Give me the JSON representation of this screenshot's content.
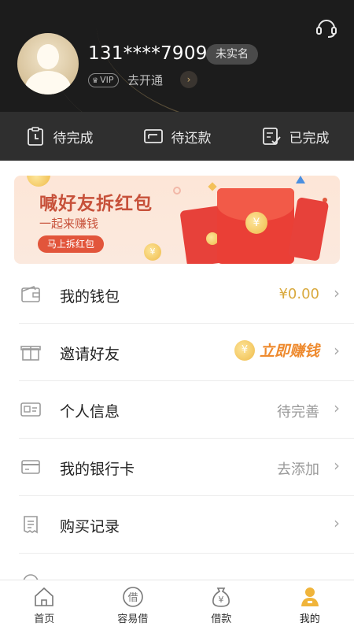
{
  "profile": {
    "phone": "131****7909",
    "real_name_status": "未实名",
    "vip_label": "VIP",
    "vip_action": "去开通"
  },
  "status_tabs": [
    {
      "label": "待完成",
      "icon": "clipboard-clock-icon"
    },
    {
      "label": "待还款",
      "icon": "card-return-icon"
    },
    {
      "label": "已完成",
      "icon": "clipboard-check-icon"
    }
  ],
  "banner": {
    "title": "喊好友拆红包",
    "subtitle": "一起来赚钱",
    "button": "马上拆红包",
    "coin_symbol": "¥"
  },
  "menu": [
    {
      "label": "我的钱包",
      "value": "¥0.00",
      "icon": "wallet-icon"
    },
    {
      "label": "邀请好友",
      "value": "立即赚钱",
      "icon": "gift-icon"
    },
    {
      "label": "个人信息",
      "value": "待完善",
      "icon": "id-card-icon"
    },
    {
      "label": "我的银行卡",
      "value": "去添加",
      "icon": "bank-card-icon"
    },
    {
      "label": "购买记录",
      "value": "",
      "icon": "receipt-icon"
    }
  ],
  "bottom_nav": [
    {
      "label": "首页",
      "icon": "home-icon"
    },
    {
      "label": "容易借",
      "icon": "borrow-icon",
      "glyph": "借"
    },
    {
      "label": "借款",
      "icon": "money-bag-icon",
      "glyph": "¥"
    },
    {
      "label": "我的",
      "icon": "user-icon",
      "active": true
    }
  ],
  "colors": {
    "accent_gold": "#d9a93d",
    "header_bg": "#1c1c1c",
    "status_bar_bg": "#2f2f2f",
    "banner_red": "#c7513a",
    "earn_orange": "#ee8a2e"
  }
}
